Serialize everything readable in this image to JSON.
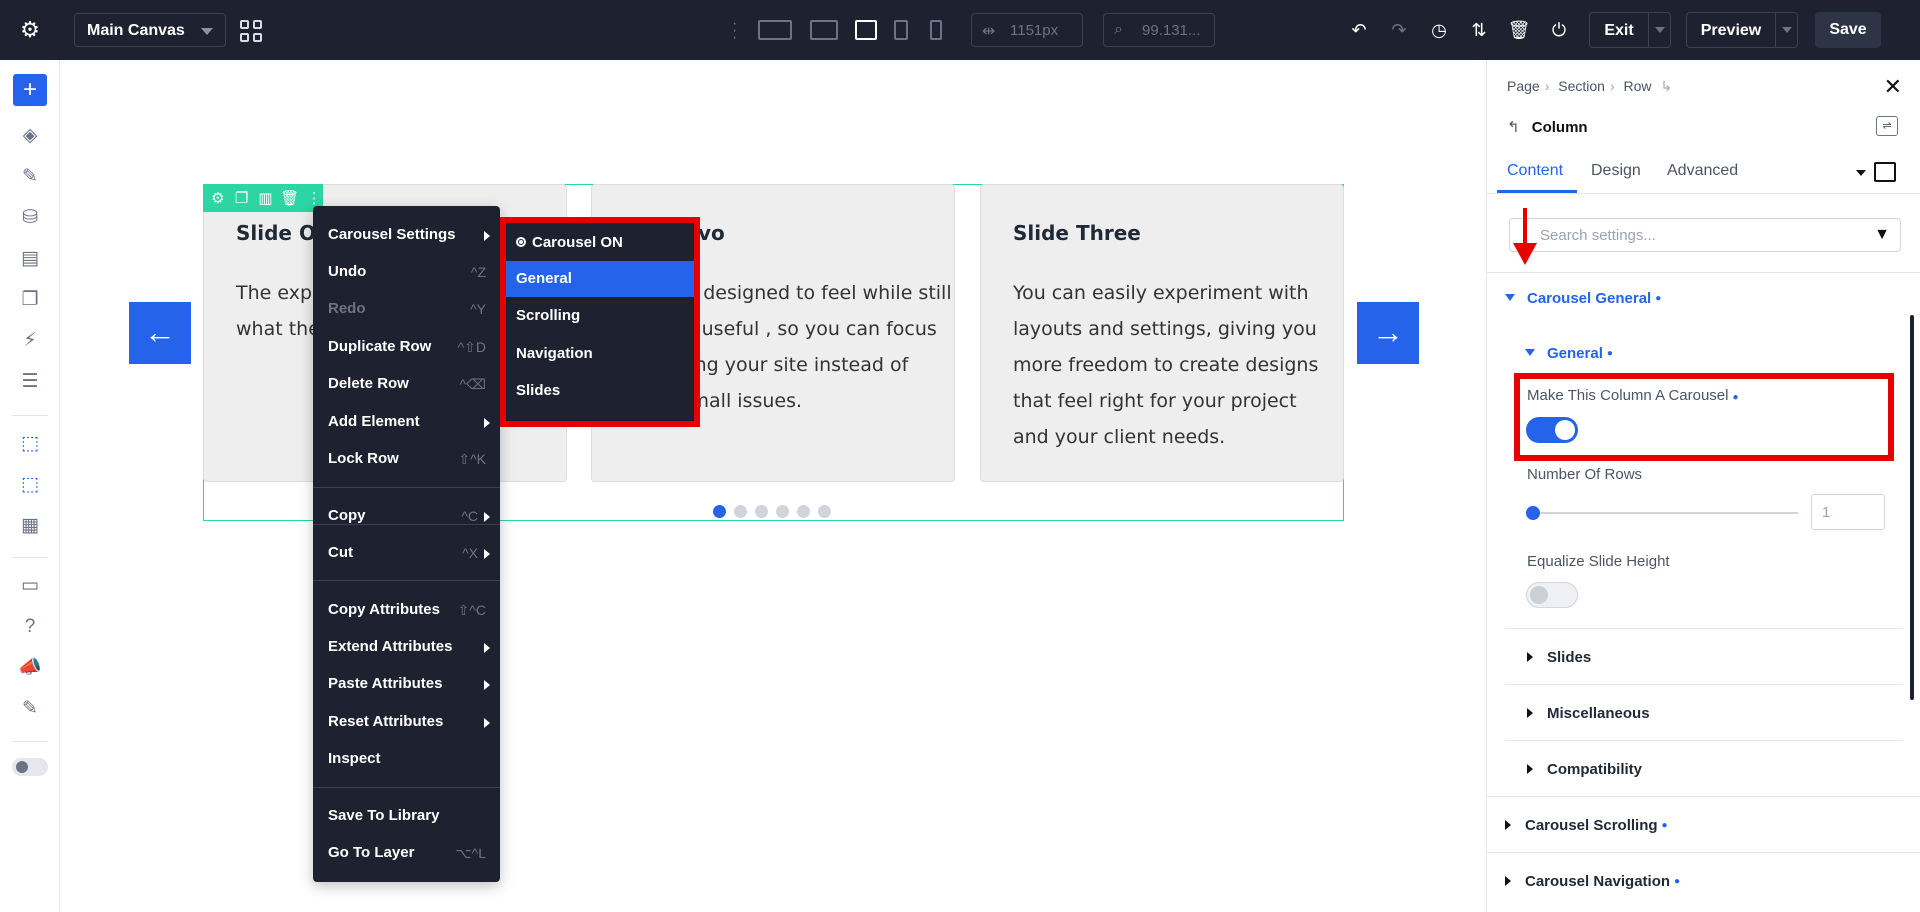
{
  "topbar": {
    "canvas_label": "Main Canvas",
    "width_value": "1151px",
    "zoom_value": "99.131...",
    "exit_label": "Exit",
    "preview_label": "Preview",
    "save_label": "Save"
  },
  "slides": [
    {
      "title": "Slide On",
      "body": "The expe natural w way you what the achieve"
    },
    {
      "title": "vo",
      "body": "ools are designed to feel while still offering useful , so you can focus more ding your site instead of fixing small issues."
    },
    {
      "title": "Slide Three",
      "body": "You can easily experiment with layouts and settings, giving you more freedom to create designs that feel right for your project and your client needs."
    }
  ],
  "carousel": {
    "dot_count": 6,
    "active_dot": 1
  },
  "context_menu": {
    "items": [
      {
        "label": "Carousel Settings",
        "shortcut": "",
        "submenu": true,
        "disabled": false
      },
      {
        "label": "Undo",
        "shortcut": "^Z",
        "submenu": false,
        "disabled": false
      },
      {
        "label": "Redo",
        "shortcut": "^Y",
        "submenu": false,
        "disabled": true
      },
      {
        "label": "Duplicate Row",
        "shortcut": "^⇧D",
        "submenu": false,
        "disabled": false
      },
      {
        "label": "Delete Row",
        "shortcut": "^⌫",
        "submenu": false,
        "disabled": false
      },
      {
        "label": "Add Element",
        "shortcut": "",
        "submenu": true,
        "disabled": false
      },
      {
        "label": "Lock Row",
        "shortcut": "⇧^K",
        "submenu": false,
        "disabled": false
      },
      {
        "label": "Copy",
        "shortcut": "^C",
        "submenu": true,
        "disabled": false
      },
      {
        "label": "Cut",
        "shortcut": "^X",
        "submenu": true,
        "disabled": false
      },
      {
        "label": "Copy Attributes",
        "shortcut": "⇧^C",
        "submenu": false,
        "disabled": false
      },
      {
        "label": "Extend Attributes",
        "shortcut": "",
        "submenu": true,
        "disabled": false
      },
      {
        "label": "Paste Attributes",
        "shortcut": "",
        "submenu": true,
        "disabled": false
      },
      {
        "label": "Reset Attributes",
        "shortcut": "",
        "submenu": true,
        "disabled": false
      },
      {
        "label": "Inspect",
        "shortcut": "",
        "submenu": false,
        "disabled": false
      },
      {
        "label": "Save To Library",
        "shortcut": "",
        "submenu": false,
        "disabled": false
      },
      {
        "label": "Go To Layer",
        "shortcut": "⌥^L",
        "submenu": false,
        "disabled": false
      }
    ]
  },
  "submenu": {
    "items": [
      {
        "label": "Carousel ON"
      },
      {
        "label": "General"
      },
      {
        "label": "Scrolling"
      },
      {
        "label": "Navigation"
      },
      {
        "label": "Slides"
      }
    ]
  },
  "panel": {
    "breadcrumb": [
      "Page",
      "Section",
      "Row"
    ],
    "title": "Column",
    "tabs": [
      "Content",
      "Design",
      "Advanced"
    ],
    "search_placeholder": "Search settings...",
    "group_carousel_general": "Carousel General",
    "sub_general": "General",
    "make_carousel_label": "Make This Column A Carousel",
    "make_carousel_on": true,
    "rows_label": "Number Of Rows",
    "rows_value": "1",
    "equalize_label": "Equalize Slide Height",
    "equalize_on": false,
    "sub_slides": "Slides",
    "sub_misc": "Miscellaneous",
    "sub_compat": "Compatibility",
    "group_scrolling": "Carousel Scrolling",
    "group_navigation": "Carousel Navigation"
  },
  "colors": {
    "accent": "#2563eb",
    "highlight": "#e60000",
    "dark": "#1e2230",
    "row_outline": "#2dd4a4"
  }
}
